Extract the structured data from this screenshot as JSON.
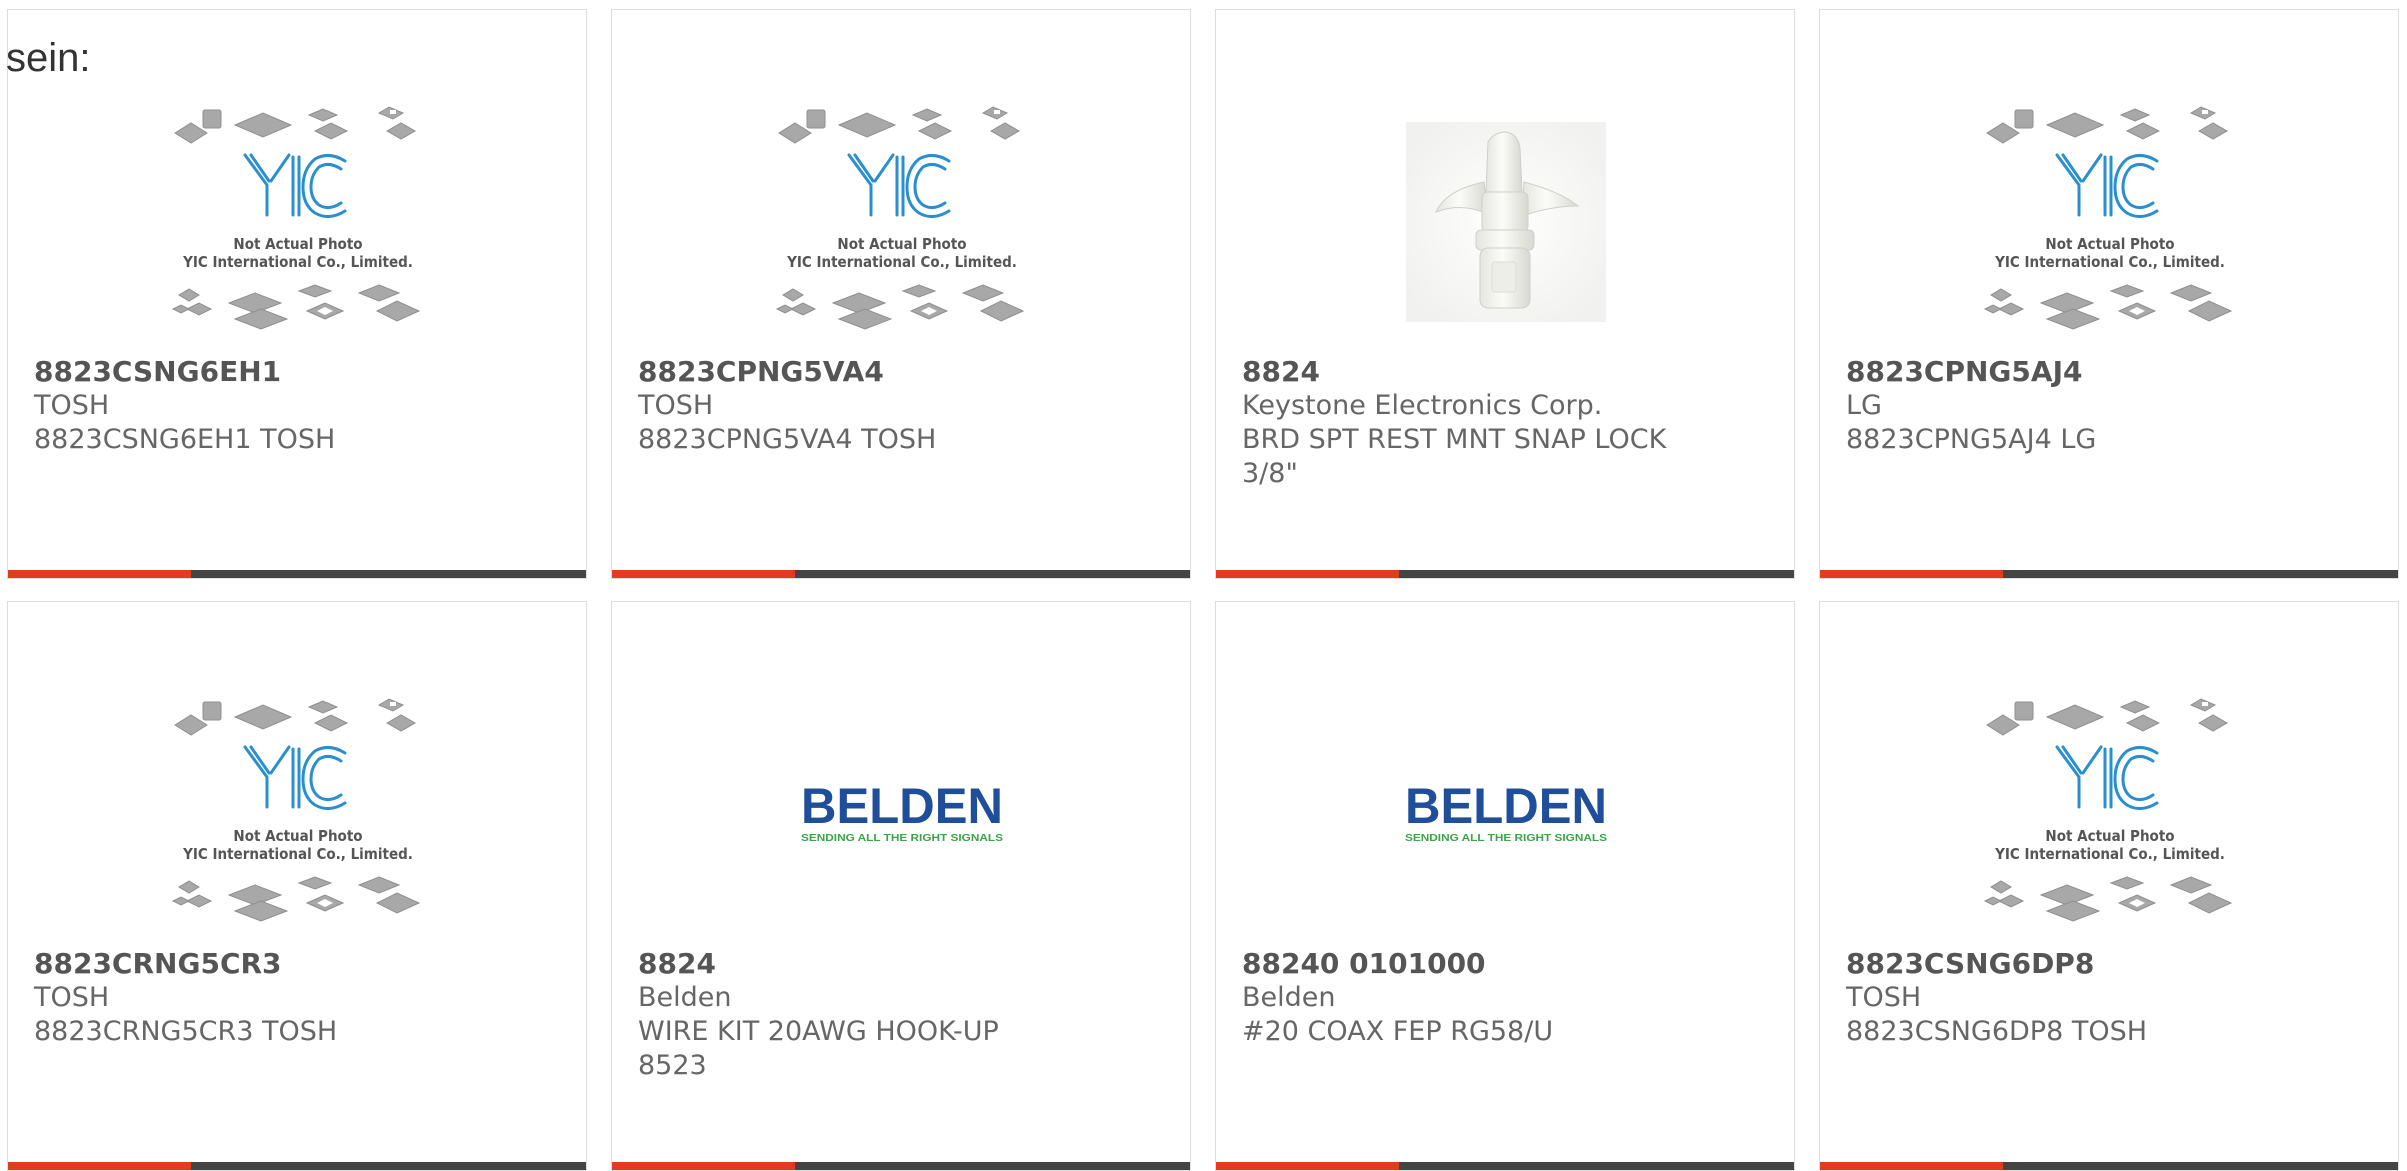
{
  "prefix_text": "sein:",
  "placeholder": {
    "brand": "YIC",
    "line1": "Not Actual Photo",
    "line2": "YIC International Co., Limited."
  },
  "belden_logo": {
    "brand": "BELDEN",
    "tagline": "SENDING ALL THE RIGHT SIGNALS",
    "color": "#1f4f9a",
    "tagline_color": "#3aa648"
  },
  "colors": {
    "accent": "#e23c1d",
    "bar": "#444444",
    "text": "#666666"
  },
  "products": [
    {
      "part_number": "8823CSNG6EH1",
      "manufacturer": "TOSH",
      "description": "8823CSNG6EH1 TOSH",
      "image": "yic-placeholder"
    },
    {
      "part_number": "8823CPNG5VA4",
      "manufacturer": "TOSH",
      "description": "8823CPNG5VA4 TOSH",
      "image": "yic-placeholder"
    },
    {
      "part_number": "8824",
      "manufacturer": "Keystone Electronics Corp.",
      "description": "BRD SPT REST MNT SNAP LOCK 3/8\"",
      "image": "snap-lock-photo"
    },
    {
      "part_number": "8823CPNG5AJ4",
      "manufacturer": "LG",
      "description": "8823CPNG5AJ4 LG",
      "image": "yic-placeholder"
    },
    {
      "part_number": "8823CRNG5CR3",
      "manufacturer": "TOSH",
      "description": "8823CRNG5CR3 TOSH",
      "image": "yic-placeholder"
    },
    {
      "part_number": "8824",
      "manufacturer": "Belden",
      "description": "WIRE KIT 20AWG HOOK-UP 8523",
      "image": "belden-logo"
    },
    {
      "part_number": "88240 0101000",
      "manufacturer": "Belden",
      "description": "#20 COAX FEP RG58/U",
      "image": "belden-logo"
    },
    {
      "part_number": "8823CSNG6DP8",
      "manufacturer": "TOSH",
      "description": "8823CSNG6DP8 TOSH",
      "image": "yic-placeholder"
    }
  ]
}
